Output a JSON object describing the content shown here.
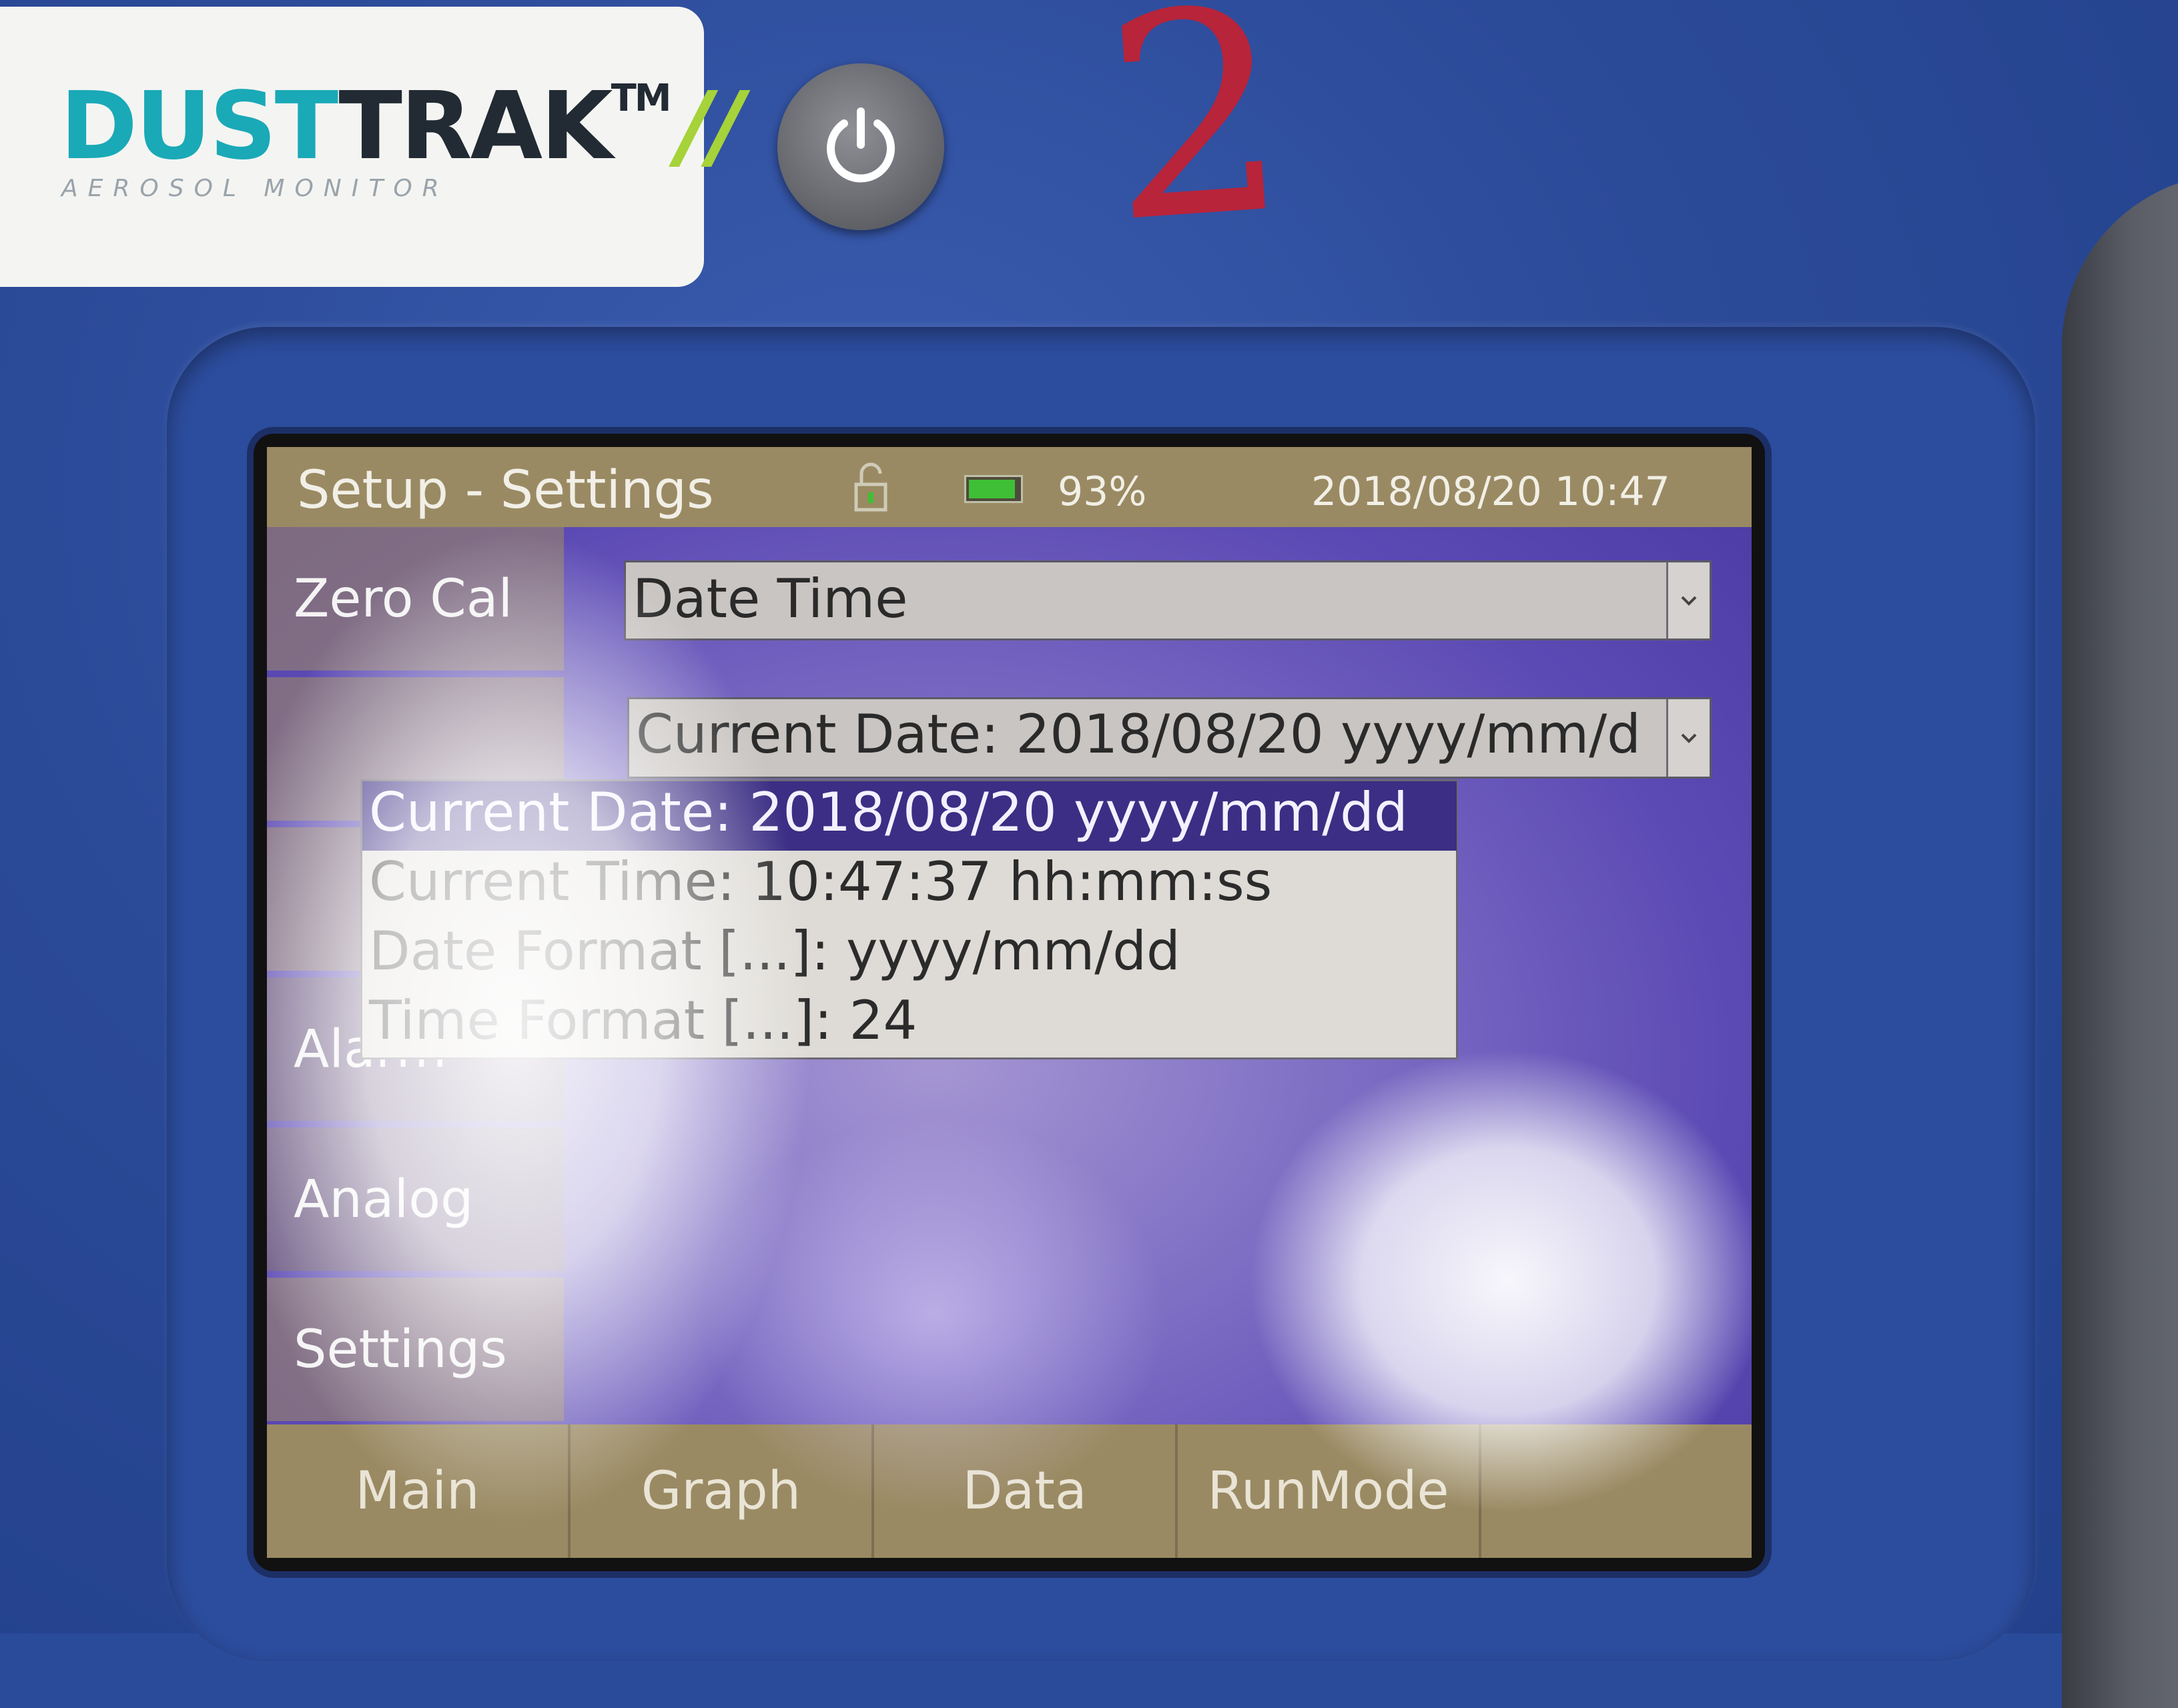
{
  "device": {
    "brand_part1": "DUST",
    "brand_part2": "TRAK",
    "brand_tm": "TM",
    "brand_slashes": "//",
    "brand_sub": "AEROSOL MONITOR",
    "handwritten_number": "2"
  },
  "status_bar": {
    "title": "Setup - Settings",
    "battery_percent": "93%",
    "battery_level": 0.93,
    "datetime": "2018/08/20 10:47"
  },
  "side_nav": {
    "items": [
      {
        "label": "Zero Cal"
      },
      {
        "label": ""
      },
      {
        "label": ""
      },
      {
        "label": "Alarm"
      },
      {
        "label": "Analog"
      },
      {
        "label": "Settings"
      }
    ]
  },
  "settings": {
    "category_select": "Date Time",
    "field_select": "Current Date: 2018/08/20 yyyy/mm/d",
    "options": [
      "Current Date: 2018/08/20 yyyy/mm/dd",
      "Current Time: 10:47:37 hh:mm:ss",
      "Date Format [...]: yyyy/mm/dd",
      "Time Format [...]: 24"
    ]
  },
  "bottom_tabs": [
    "Main",
    "Graph",
    "Data",
    "RunMode"
  ],
  "colors": {
    "device_blue": "#2b4a98",
    "status_bar": "#9a8a63",
    "selected_item": "#3b2e84",
    "battery_green": "#3fbf35"
  }
}
